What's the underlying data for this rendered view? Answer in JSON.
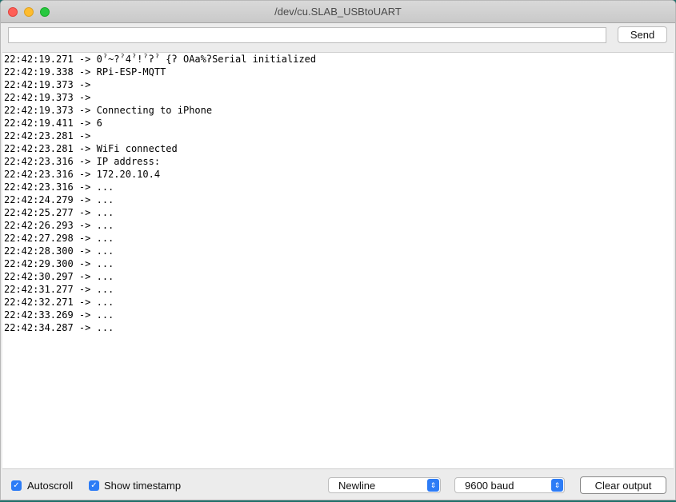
{
  "window": {
    "title": "/dev/cu.SLAB_USBtoUART"
  },
  "input": {
    "value": ""
  },
  "send_label": "Send",
  "output_lines": [
    "22:42:19.271 -> 0ˀ~?ˀ4ˀ!ˀʔˀ {ʔ OAa%ʔSerial initialized",
    "22:42:19.338 -> RPi-ESP-MQTT",
    "22:42:19.373 ->",
    "22:42:19.373 ->",
    "22:42:19.373 -> Connecting to iPhone",
    "22:42:19.411 -> 6",
    "22:42:23.281 ->",
    "22:42:23.281 -> WiFi connected",
    "22:42:23.316 -> IP address:",
    "22:42:23.316 -> 172.20.10.4",
    "22:42:23.316 -> ...",
    "22:42:24.279 -> ...",
    "22:42:25.277 -> ...",
    "22:42:26.293 -> ...",
    "22:42:27.298 -> ...",
    "22:42:28.300 -> ...",
    "22:42:29.300 -> ...",
    "22:42:30.297 -> ...",
    "22:42:31.277 -> ...",
    "22:42:32.271 -> ...",
    "22:42:33.269 -> ...",
    "22:42:34.287 -> ..."
  ],
  "footer": {
    "autoscroll_label": "Autoscroll",
    "autoscroll_checked": true,
    "timestamp_label": "Show timestamp",
    "timestamp_checked": true,
    "line_ending": "Newline",
    "baud_rate": "9600 baud",
    "clear_label": "Clear output"
  },
  "colors": {
    "accent": "#2d7cf6",
    "close": "#fe5f57",
    "minimize": "#febc2e",
    "zoom": "#28c840"
  }
}
